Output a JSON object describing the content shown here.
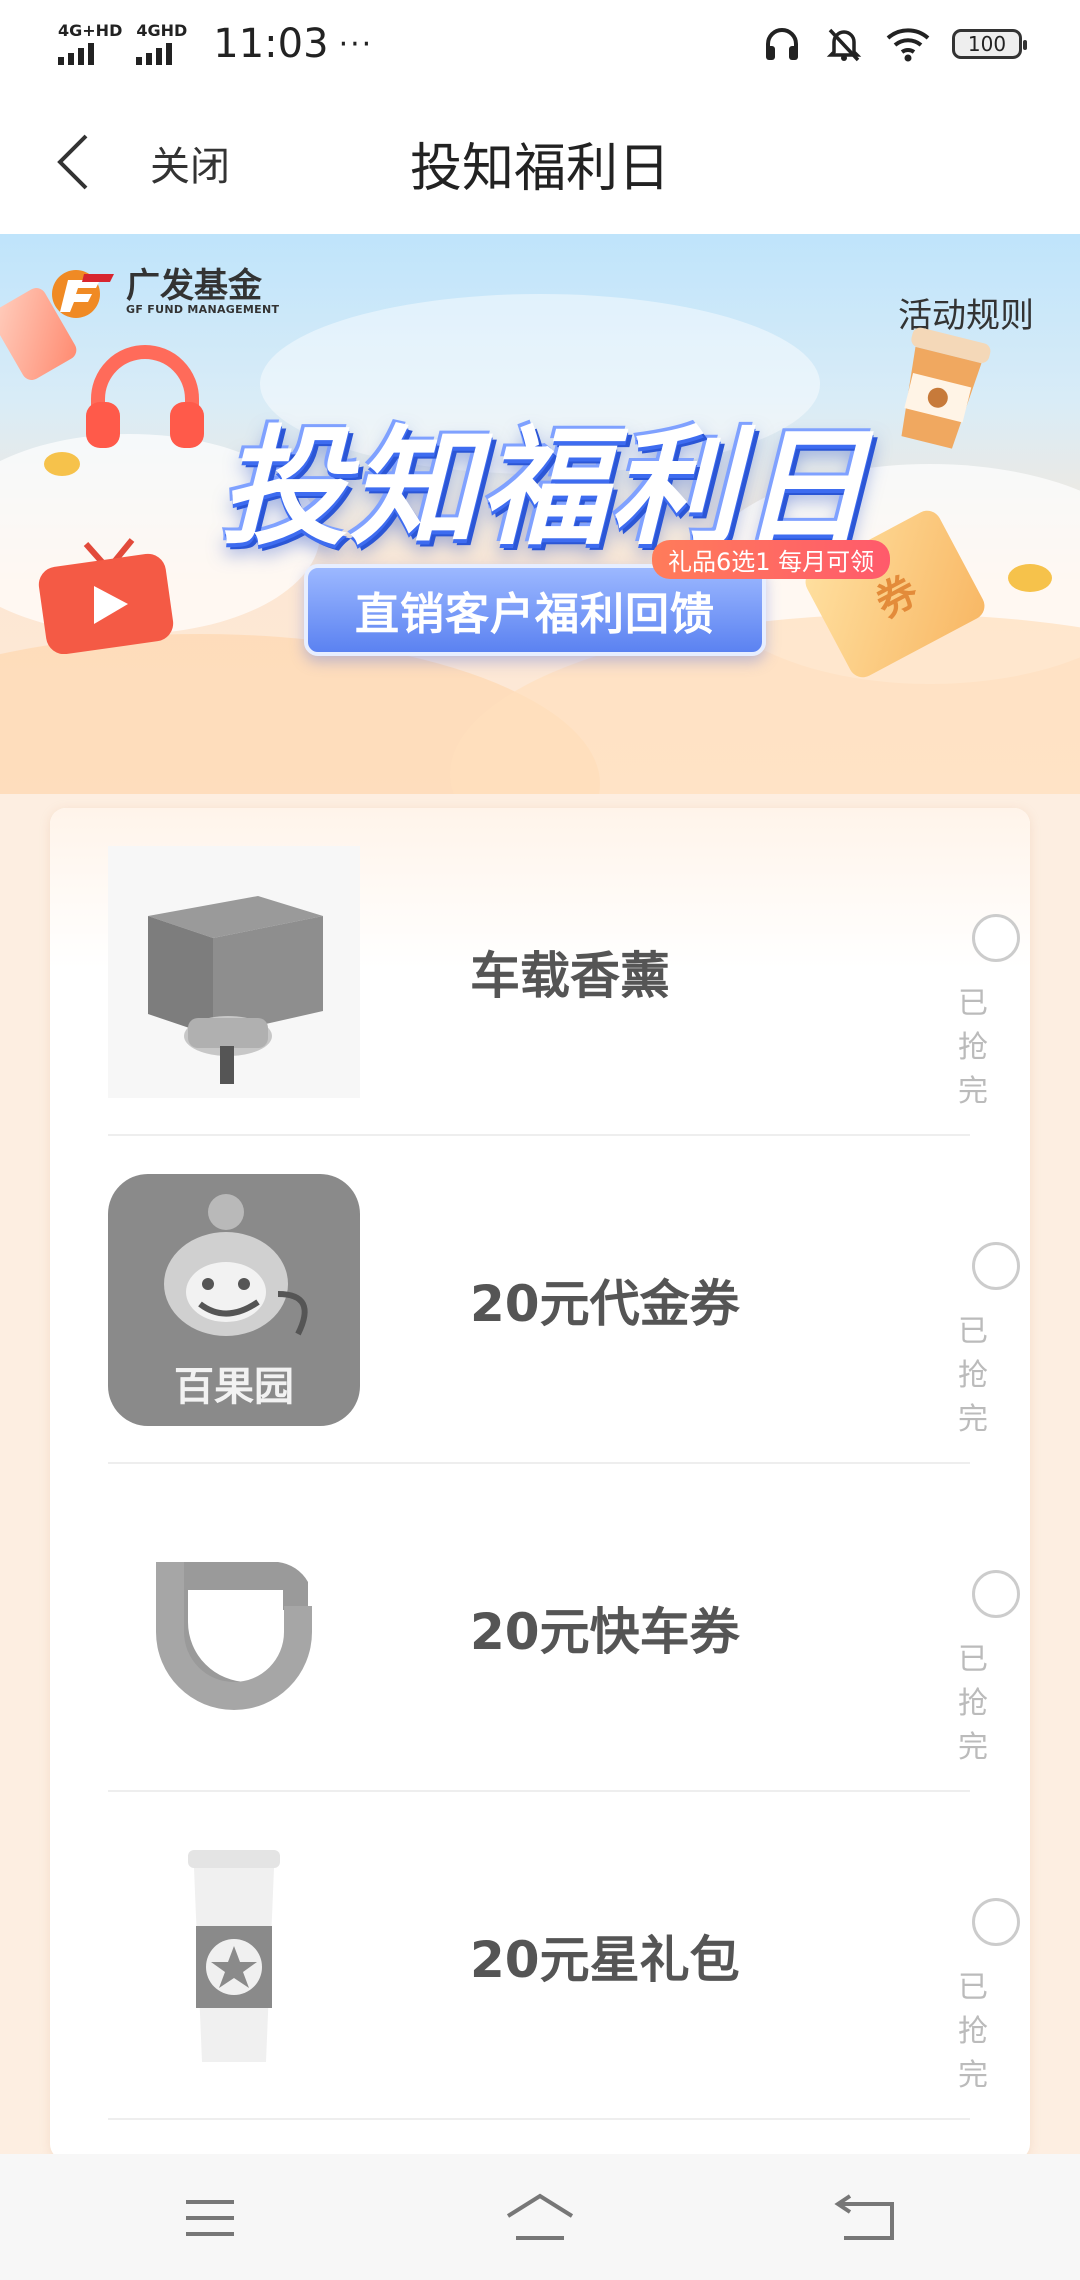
{
  "status_bar": {
    "sim1": "4G+HD",
    "sim2": "4GHD",
    "time": "11:03",
    "more": "···",
    "battery": "100"
  },
  "nav": {
    "close_label": "关闭",
    "title": "投知福利日"
  },
  "banner": {
    "brand_cn": "广发基金",
    "brand_en": "GF FUND MANAGEMENT",
    "rules": "活动规则",
    "title": "投知福利日",
    "badge": "礼品6选1 每月可领",
    "subtitle": "直销客户福利回馈",
    "ticket_char": "券"
  },
  "gifts": [
    {
      "name": "车载香薰",
      "status": "已抢完",
      "thumb_text": ""
    },
    {
      "name": "20元代金券",
      "status": "已抢完",
      "thumb_text": "百果园"
    },
    {
      "name": "20元快车券",
      "status": "已抢完",
      "thumb_text": ""
    },
    {
      "name": "20元星礼包",
      "status": "已抢完",
      "thumb_text": ""
    }
  ],
  "colors": {
    "page_bg": "#fdeee1",
    "title_blue": "#3e6cf0",
    "badge_red": "#ff5a6b",
    "sold_gray": "#bbbbbb"
  },
  "icons": [
    "back-chevron-icon",
    "headphones-icon",
    "mute-bell-icon",
    "wifi-icon",
    "menu-icon",
    "home-icon",
    "back-icon"
  ]
}
